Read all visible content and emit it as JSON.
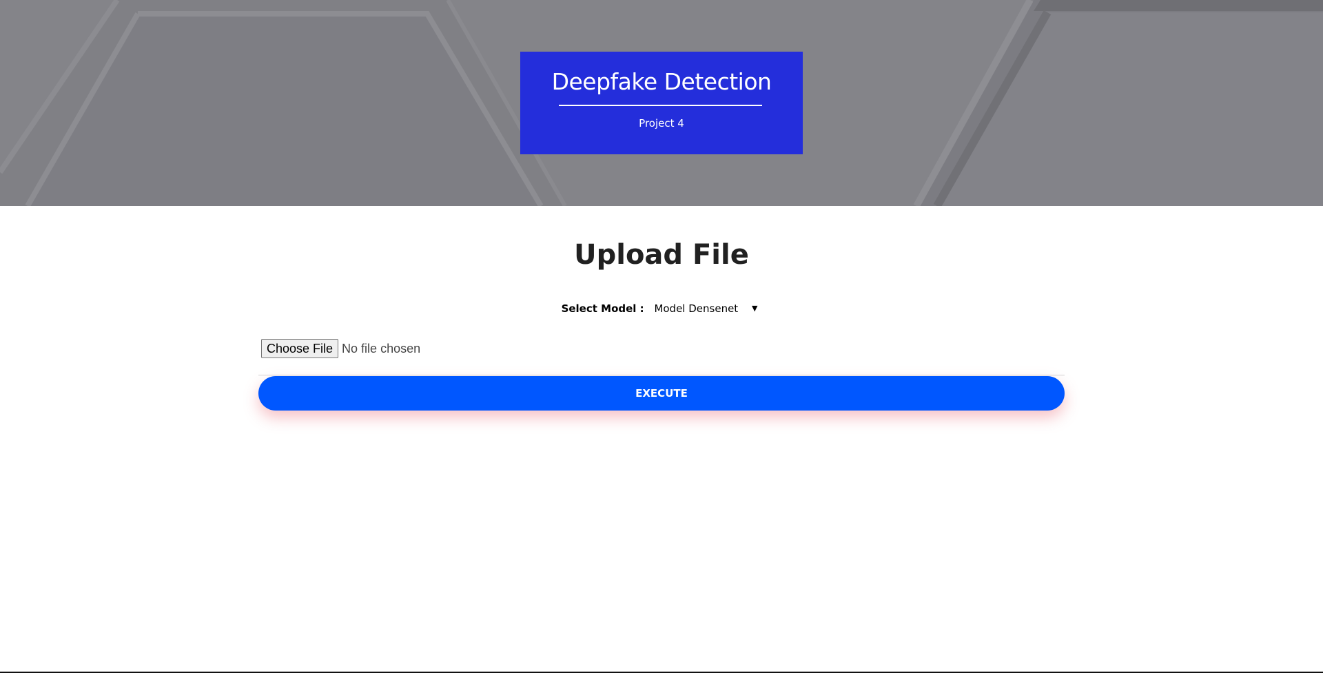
{
  "hero": {
    "title": "Deepfake Detection",
    "subtitle": "Project 4"
  },
  "main": {
    "heading": "Upload File",
    "model_label": "Select Model :",
    "model_selected": "Model Densenet",
    "choose_file_label": "Choose File",
    "file_status": "No file chosen",
    "execute_label": "EXECUTE"
  },
  "colors": {
    "title_box": "#242edb",
    "execute_button": "#0057ff",
    "hero_background": "#838388"
  },
  "icons": {
    "select_chevron": "chevron-down-icon"
  }
}
